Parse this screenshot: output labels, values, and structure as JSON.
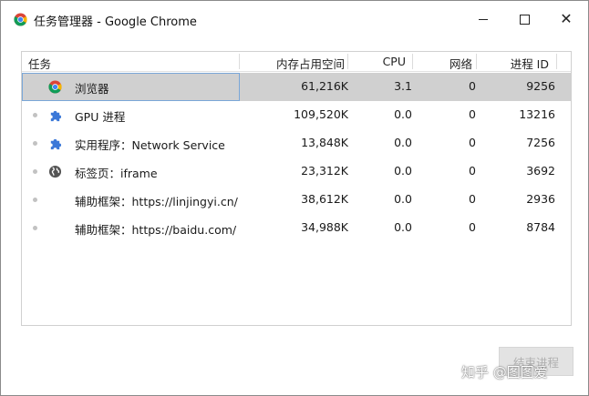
{
  "window": {
    "title": "任务管理器 - Google Chrome",
    "icon": "chrome-icon"
  },
  "table": {
    "headers": {
      "task": "任务",
      "memory": "内存占用空间",
      "cpu": "CPU",
      "network": "网络",
      "pid": "进程 ID"
    },
    "rows": [
      {
        "icon": "chrome-icon",
        "name": "浏览器",
        "memory": "61,216K",
        "cpu": "3.1",
        "network": "0",
        "pid": "9256",
        "selected": true
      },
      {
        "icon": "puzzle-icon",
        "name": "GPU 进程",
        "memory": "109,520K",
        "cpu": "0.0",
        "network": "0",
        "pid": "13216"
      },
      {
        "icon": "puzzle-icon",
        "name": "实用程序：Network Service",
        "memory": "13,848K",
        "cpu": "0.0",
        "network": "0",
        "pid": "7256"
      },
      {
        "icon": "globe-icon",
        "name": "标签页：iframe",
        "memory": "23,312K",
        "cpu": "0.0",
        "network": "0",
        "pid": "3692"
      },
      {
        "icon": "",
        "name": "辅助框架：https://linjingyi.cn/",
        "memory": "38,612K",
        "cpu": "0.0",
        "network": "0",
        "pid": "2936"
      },
      {
        "icon": "",
        "name": "辅助框架：https://baidu.com/",
        "memory": "34,988K",
        "cpu": "0.0",
        "network": "0",
        "pid": "8784"
      }
    ]
  },
  "actions": {
    "end_process": "结束进程"
  },
  "watermark": "知乎 @图图爱",
  "colors": {
    "selected_row": "#d0d0d0",
    "focus_border": "#7aa7d8",
    "puzzle_blue": "#3b78d8"
  }
}
